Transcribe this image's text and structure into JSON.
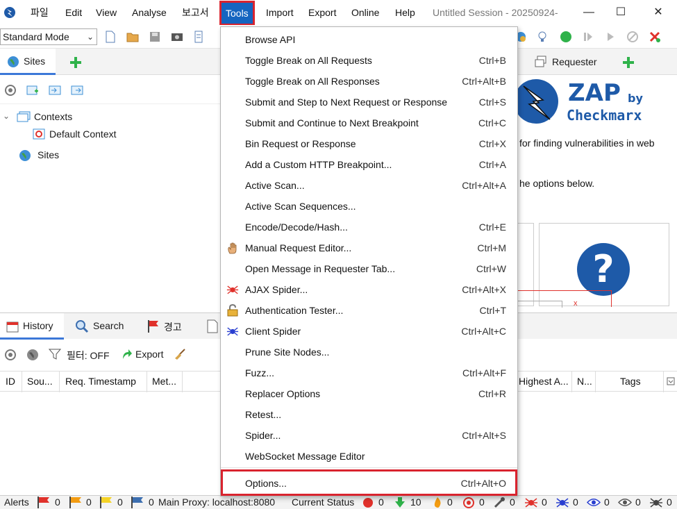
{
  "menubar": {
    "items": [
      "파일",
      "Edit",
      "View",
      "Analyse",
      "보고서",
      "Tools",
      "Import",
      "Export",
      "Online",
      "Help"
    ],
    "window_title": "Untitled Session - 20250924-",
    "minimize": "—",
    "maximize": "☐",
    "close": "✕"
  },
  "toolbar": {
    "mode": "Standard Mode"
  },
  "sites": {
    "tab_label": "Sites",
    "tree": {
      "contexts": "Contexts",
      "default_context": "Default Context",
      "sites": "Sites"
    }
  },
  "right": {
    "requester_tab": "Requester",
    "logo_main": "ZAP",
    "logo_by": "by",
    "logo_brand": "Checkmarx",
    "text1": "for finding vulnerabilities in web",
    "text2": "he options below.",
    "small_x": "x",
    "help_glyph": "?"
  },
  "history": {
    "tabs": [
      "History",
      "Search",
      "경고"
    ],
    "filter": "필터: OFF",
    "export": "Export",
    "columns": [
      "ID",
      "Sou...",
      "Req. Timestamp",
      "Met...",
      "Highest A...",
      "N...",
      "Tags"
    ]
  },
  "status": {
    "alerts_label": "Alerts",
    "alert_counts": [
      "0",
      "0",
      "0",
      "0"
    ],
    "proxy": "Main Proxy: localhost:8080",
    "current_status": "Current Status",
    "counts": [
      "0",
      "10",
      "0",
      "0",
      "0",
      "0",
      "0",
      "0",
      "0",
      "0"
    ]
  },
  "tools_menu": {
    "items": [
      {
        "label": "Browse API",
        "shortcut": ""
      },
      {
        "label": "Toggle Break on All Requests",
        "shortcut": "Ctrl+B"
      },
      {
        "label": "Toggle Break on All Responses",
        "shortcut": "Ctrl+Alt+B"
      },
      {
        "label": "Submit and Step to Next Request or Response",
        "shortcut": "Ctrl+S"
      },
      {
        "label": "Submit and Continue to Next Breakpoint",
        "shortcut": "Ctrl+C"
      },
      {
        "label": "Bin Request or Response",
        "shortcut": "Ctrl+X"
      },
      {
        "label": "Add a Custom HTTP Breakpoint...",
        "shortcut": "Ctrl+A"
      },
      {
        "label": "Active Scan...",
        "shortcut": "Ctrl+Alt+A"
      },
      {
        "label": "Active Scan Sequences...",
        "shortcut": ""
      },
      {
        "label": "Encode/Decode/Hash...",
        "shortcut": "Ctrl+E"
      },
      {
        "label": "Manual Request Editor...",
        "shortcut": "Ctrl+M"
      },
      {
        "label": "Open Message in Requester Tab...",
        "shortcut": "Ctrl+W"
      },
      {
        "label": "AJAX Spider...",
        "shortcut": "Ctrl+Alt+X"
      },
      {
        "label": "Authentication Tester...",
        "shortcut": "Ctrl+T"
      },
      {
        "label": "Client Spider",
        "shortcut": "Ctrl+Alt+C"
      },
      {
        "label": "Prune Site Nodes...",
        "shortcut": ""
      },
      {
        "label": "Fuzz...",
        "shortcut": "Ctrl+Alt+F"
      },
      {
        "label": "Replacer Options",
        "shortcut": "Ctrl+R"
      },
      {
        "label": "Retest...",
        "shortcut": ""
      },
      {
        "label": "Spider...",
        "shortcut": "Ctrl+Alt+S"
      },
      {
        "label": "WebSocket Message Editor",
        "shortcut": ""
      },
      {
        "label": "Options...",
        "shortcut": "Ctrl+Alt+O"
      }
    ]
  },
  "colors": {
    "highlight_red": "#d9232e",
    "tools_active": "#1565c0",
    "zap_blue": "#1e5aa8"
  }
}
